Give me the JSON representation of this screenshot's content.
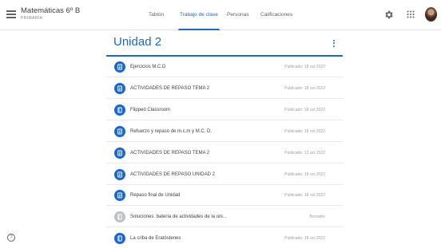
{
  "header": {
    "class_name": "Matemáticas 6º B",
    "class_section": "PRIMARIA",
    "tabs": [
      {
        "label": "Tablón"
      },
      {
        "label": "Trabajo de clase"
      },
      {
        "label": "Personas"
      },
      {
        "label": "Calificaciones"
      }
    ],
    "active_tab": "Trabajo de clase",
    "icons": [
      "menu-icon",
      "gear-icon",
      "apps-icon",
      "avatar"
    ]
  },
  "topic": {
    "title": "Unidad 2",
    "accent_color": "#1967d2"
  },
  "items": [
    {
      "title": "Ejercicios M.C.D",
      "date": "Publicado: 18 oct 2022",
      "icon": "assignment-icon"
    },
    {
      "title": "ACTIVIDADES DE REPASO TEMA 2",
      "date": "Publicado: 18 oct 2022",
      "icon": "assignment-icon"
    },
    {
      "title": "Flipped Classroom",
      "date": "Publicado: 18 oct 2022",
      "icon": "material-icon"
    },
    {
      "title": "Refuerzo y repaso de m.c.m y M.C. D.",
      "date": "Publicado: 18 oct 2022",
      "icon": "assignment-icon"
    },
    {
      "title": "ACTIVIDADES DE REPASO TEMA 2",
      "date": "Publicado: 13 oct 2022",
      "icon": "assignment-icon"
    },
    {
      "title": "ACTIVIDADES DE REPASO UNIDAD 2",
      "date": "Publicado: 18 oct 2022",
      "icon": "assignment-icon"
    },
    {
      "title": "Repaso final de Unidad",
      "date": "Publicado: 18 oct 2022",
      "icon": "assignment-icon"
    },
    {
      "title": "Soluciones: batería de actividades de la uni...",
      "date": "Borrador",
      "icon": "draft-material-icon"
    },
    {
      "title": "La criba de Eratóstenes",
      "date": "Publicado: 18 oct 2022",
      "icon": "material-icon"
    }
  ],
  "help": {
    "label": "?"
  }
}
